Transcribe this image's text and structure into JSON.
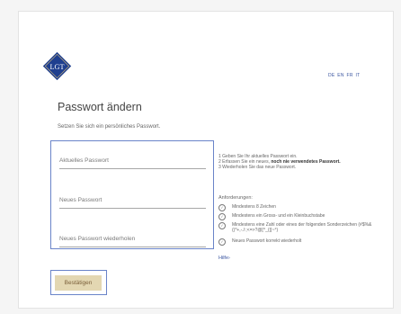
{
  "brand": {
    "logo_text": "LGT",
    "logo_color": "#1f3f8f",
    "accent_gold": "#c9b27a"
  },
  "language_switcher": {
    "de": "DE",
    "en": "EN",
    "fr": "FR",
    "it": "IT"
  },
  "page": {
    "title": "Passwort ändern",
    "subtitle": "Setzen Sie sich ein persönliches Passwort."
  },
  "fields": {
    "current_password_placeholder": "Aktuelles Passwort",
    "new_password_placeholder": "Neues Passwort",
    "repeat_password_placeholder": "Neues Passwort wiederholen"
  },
  "instructions": {
    "line1": "1 Geben Sie Ihr aktuelles Passwort ein.",
    "line2_prefix": "2 Erfassen Sie ein neues, ",
    "line2_bold": "noch nie verwendetes Passwort.",
    "line3": "3 Wiederholen Sie das neue Passwort."
  },
  "requirements": {
    "title": "Anforderungen:",
    "items": [
      "Mindestens 8 Zeichen",
      "Mindestens ein Gross- und ein Kleinbuchstabe",
      "Mindestens eine Zahl oder eines der folgenden Sonderzeichen (#$%&()*+,-./:;<=>?@[^_{|}~°)",
      "Neues Passwort korrekt wiederholt"
    ]
  },
  "help": {
    "label": "Hilfe"
  },
  "actions": {
    "confirm_label": "Bestätigen"
  },
  "colors": {
    "focus_outline": "#6a84c9",
    "link": "#3a55a0",
    "button_bg": "#e3d7b2",
    "button_text": "#7a5f3a"
  }
}
